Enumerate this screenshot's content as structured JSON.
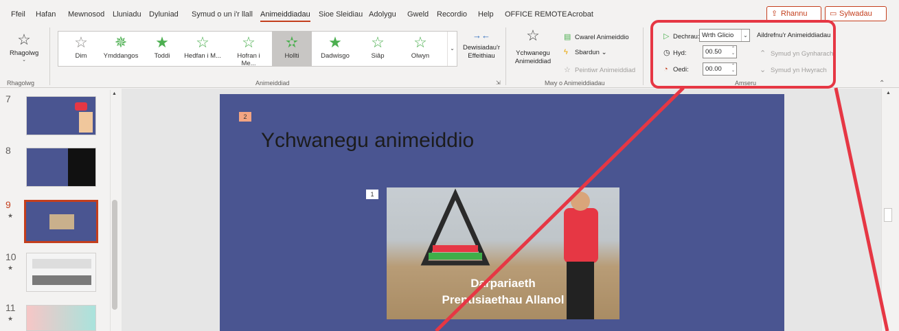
{
  "menu": {
    "tabs": [
      "Ffeil",
      "Hafan",
      "Mewnosod",
      "Lluniadu",
      "Dyluniad",
      "Symud o un i'r llall",
      "Animeiddiadau",
      "Sioe Sleidiau",
      "Adolygu",
      "Gweld",
      "Recordio",
      "Help",
      "OFFICE REMOTE",
      "Acrobat"
    ],
    "active": "Animeiddiadau",
    "share_label": "Rhannu",
    "comments_label": "Sylwadau"
  },
  "ribbon": {
    "preview": {
      "label": "Rhagolwg",
      "group": "Rhagolwg"
    },
    "animation_gallery": {
      "items": [
        {
          "label": "Dim",
          "color": "#8a8886"
        },
        {
          "label": "Ymddangos",
          "color": "#4caf50"
        },
        {
          "label": "Toddi",
          "color": "#4caf50"
        },
        {
          "label": "Hedfan i M...",
          "color": "#4caf50"
        },
        {
          "label": "Hofran i Me...",
          "color": "#4caf50"
        },
        {
          "label": "Hollti",
          "color": "#4caf50"
        },
        {
          "label": "Dadwisgo",
          "color": "#4caf50"
        },
        {
          "label": "Siâp",
          "color": "#4caf50"
        },
        {
          "label": "Olwyn",
          "color": "#4caf50"
        }
      ],
      "selected": "Hollti",
      "group": "Animeiddiad"
    },
    "effect_options": "Dewisiadau'r Effeithiau",
    "advanced": {
      "add_animation": "Ychwanegu Animeiddiad",
      "pane": "Cwarel Animeiddio",
      "trigger": "Sbardun",
      "painter": "Peintiwr Animeiddiad",
      "group": "Mwy o Animeiddiadau"
    },
    "timing": {
      "start_label": "Dechrau:",
      "start_value": "Wrth Glicio",
      "duration_label": "Hyd:",
      "duration_value": "00.50",
      "delay_label": "Oedi:",
      "delay_value": "00.00",
      "reorder": "Aildrefnu'r Animeiddiadau",
      "move_earlier": "Symud yn Gynharach",
      "move_later": "Symud yn Hwyrach",
      "group": "Amseru"
    }
  },
  "thumbnails": [
    {
      "num": "7",
      "star": ""
    },
    {
      "num": "8",
      "star": ""
    },
    {
      "num": "9",
      "star": "★"
    },
    {
      "num": "10",
      "star": "★"
    },
    {
      "num": "11",
      "star": "★"
    }
  ],
  "slide": {
    "title": "Ychwanegu animeiddio",
    "tag_title": "2",
    "tag_photo": "1",
    "photo_caption_line1": "Darpariaeth",
    "photo_caption_line2": "Prentisiaethau Allanol"
  },
  "colors": {
    "accent": "#c43e1c",
    "slide_bg": "#4a5591",
    "highlight": "#e63744"
  }
}
